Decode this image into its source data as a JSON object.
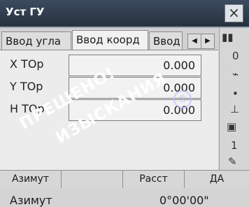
{
  "window": {
    "title": "Уст ГУ",
    "close_label": "×"
  },
  "tabs": {
    "items": [
      {
        "label": "Ввод угла"
      },
      {
        "label": "Ввод коорд"
      },
      {
        "label": "Ввод"
      }
    ],
    "left_arrow": "◀",
    "right_arrow": "▶"
  },
  "fields": [
    {
      "label": "X TOp",
      "value": "0.000"
    },
    {
      "label": "Y TOp",
      "value": "0.000"
    },
    {
      "label": "H TOp",
      "value": "0.000"
    }
  ],
  "azimuth": {
    "label": "Азимут",
    "value": "0°00'00\""
  },
  "status_panel": [
    {
      "icon": "battery-icon",
      "text": "▮▮"
    },
    {
      "icon": "signal-icon",
      "text": "0"
    },
    {
      "icon": "prism-icon",
      "text": "⌁"
    },
    {
      "icon": "dot-icon",
      "text": "•"
    },
    {
      "icon": "level-icon",
      "text": "⊥"
    },
    {
      "icon": "target-icon",
      "text": "▣"
    },
    {
      "icon": "tilt-icon",
      "text": "1"
    },
    {
      "icon": "pencil-icon",
      "text": "✎"
    }
  ],
  "softkeys": [
    {
      "label": "Азимут"
    },
    {
      "label": ""
    },
    {
      "label": "Расст"
    },
    {
      "label": "ДА"
    }
  ],
  "watermark": {
    "line1": "ПРЕШЕНО!",
    "line2": "ИЗЫСКАНИЯ",
    "logo": "®"
  }
}
